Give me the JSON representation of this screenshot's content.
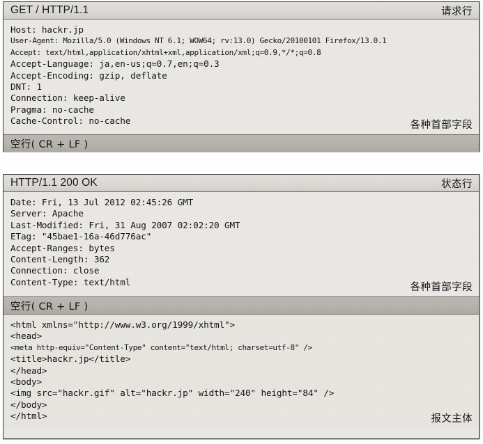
{
  "request": {
    "start_line": "GET / HTTP/1.1",
    "start_line_label": "请求行",
    "headers": [
      "Host: hackr.jp",
      "User-Agent: Mozilla/5.0 (Windows NT 6.1; WOW64; rv:13.0) Gecko/20100101 Firefox/13.0.1",
      "Accept: text/html,application/xhtml+xml,application/xml;q=0.9,*/*;q=0.8",
      "Accept-Language: ja,en-us;q=0.7,en;q=0.3",
      "Accept-Encoding: gzip, deflate",
      "DNT: 1",
      "Connection: keep-alive",
      "Pragma: no-cache",
      "Cache-Control: no-cache"
    ],
    "headers_label": "各种首部字段",
    "blank_line_label": "空行( CR + LF )"
  },
  "response": {
    "start_line": "HTTP/1.1 200 OK",
    "start_line_label": "状态行",
    "headers": [
      "Date: Fri, 13 Jul 2012 02:45:26 GMT",
      "Server: Apache",
      "Last-Modified: Fri, 31 Aug 2007 02:02:20 GMT",
      "ETag: \"45bae1-16a-46d776ac\"",
      "Accept-Ranges: bytes",
      "Content-Length: 362",
      "Connection: close",
      "Content-Type: text/html"
    ],
    "headers_label": "各种首部字段",
    "blank_line_label": "空行( CR + LF )",
    "body": [
      "<html xmlns=\"http://www.w3.org/1999/xhtml\">",
      "<head>",
      "<meta http-equiv=\"Content-Type\" content=\"text/html; charset=utf-8\" />",
      "<title>hackr.jp</title>",
      "</head>",
      "<body>",
      "<img src=\"hackr.gif\" alt=\"hackr.jp\" width=\"240\" height=\"84\" />",
      "</body>",
      "</html>"
    ],
    "body_label": "报文主体"
  },
  "colors": {
    "paper": "#eceae6",
    "band": "#dedcd7",
    "blank_band": "#b7b4ae",
    "border": "#3a3a3a",
    "text": "#141414"
  }
}
